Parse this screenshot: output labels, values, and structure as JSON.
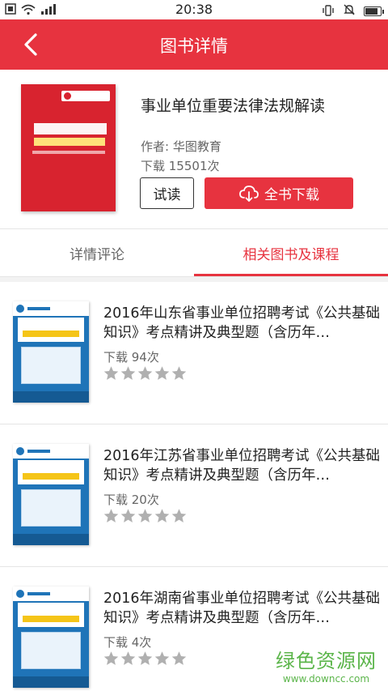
{
  "status_bar": {
    "time": "20:38"
  },
  "header": {
    "title": "图书详情",
    "back_icon": "chevron-left-icon"
  },
  "book": {
    "title": "事业单位重要法律法规解读",
    "author": "作者: 华图教育",
    "downloads": "下载 15501次",
    "preview_label": "试读",
    "download_label": "全书下载",
    "download_icon": "cloud-download-icon",
    "cover_color": "#d8232f"
  },
  "tabs": [
    {
      "label": "详情评论",
      "active": false
    },
    {
      "label": "相关图书及课程",
      "active": true
    }
  ],
  "related": [
    {
      "title": "2016年山东省事业单位招聘考试《公共基础知识》考点精讲及典型题（含历年…",
      "downloads": "下载 94次",
      "rating": 0
    },
    {
      "title": "2016年江苏省事业单位招聘考试《公共基础知识》考点精讲及典型题（含历年…",
      "downloads": "下载 20次",
      "rating": 0
    },
    {
      "title": "2016年湖南省事业单位招聘考试《公共基础知识》考点精讲及典型题（含历年…",
      "downloads": "下载 4次",
      "rating": 0
    }
  ],
  "watermark": {
    "main": "绿色资源网",
    "sub": "www.downcc.com"
  },
  "colors": {
    "accent": "#e7333f",
    "star_empty": "#b0b0b0",
    "watermark": "#5bb54a"
  }
}
